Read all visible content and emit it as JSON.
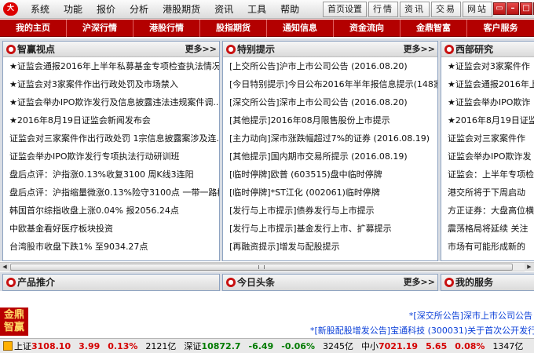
{
  "titlebar": {
    "logo": "大",
    "menu": [
      "系统",
      "功能",
      "报价",
      "分析",
      "港股期货",
      "资讯",
      "工具",
      "帮助"
    ],
    "quick_buttons": [
      "首页设置",
      "行情",
      "资讯",
      "交易",
      "网站"
    ],
    "window_controls": [
      "▭",
      "–",
      "□",
      "✕"
    ]
  },
  "navbar": {
    "items": [
      "我的主页",
      "沪深行情",
      "港股行情",
      "股指期货",
      "通知信息",
      "资金流向",
      "金鼎智富",
      "客户服务"
    ]
  },
  "panels": {
    "zhiying": {
      "title": "智赢视点",
      "more": "更多>>",
      "items": [
        "★证监会通报2016年上半年私募基金专项检查执法情况",
        "★证监会对3家案件作出行政处罚及市场禁入",
        "★证监会举办IPO欺诈发行及信息披露违法违规案件调...",
        "★2016年8月19日证监会新闻发布会",
        "证监会对三家案件作出行政处罚 1宗信息披露案涉及连...",
        "证监会举办IPO欺诈发行专项执法行动研训班",
        "盘后点评：沪指涨0.13%收复3100 周K线3连阳",
        "盘后点评：沪指缩量微涨0.13%险守3100点 一带一路概...",
        "韩国首尔综指收盘上涨0.04% 报2056.24点",
        "中欧基金看好医疗板块投资",
        "台湾股市收盘下跌1% 至9034.27点"
      ]
    },
    "tebie": {
      "title": "特别提示",
      "more": "更多>>",
      "items": [
        "[上交所公告]沪市上市公司公告 (2016.08.20)",
        "[今日特别提示]今日公布2016年半年报信息提示(148家)",
        "[深交所公告]深市上市公司公告 (2016.08.20)",
        "[其他提示]2016年08月限售股份上市提示",
        "[主力动向]深市涨跌幅超过7%的证券 (2016.08.19)",
        "[其他提示]国内期市交易所提示 (2016.08.19)",
        "[临时停牌]欧普 (603515)盘中临时停牌",
        "[临时停牌]*ST江化 (002061)临时停牌",
        "[发行与上市提示]债券发行与上市提示",
        "[发行与上市提示]基金发行上市、扩募提示",
        "[再融资提示]增发与配股提示"
      ]
    },
    "xibu": {
      "title": "西部研究",
      "items": [
        "★证监会对3家案件作",
        "★证监会通报2016年上",
        "★证监会举办IPO欺诈",
        "★2016年8月19日证监会",
        "证监会对三家案件作",
        "证监会举办IPO欺诈发",
        "证监会：上半年专项检",
        "港交所将于下周启动",
        "方正证券：大盘高位横",
        "震荡格局将延续 关注",
        "市场有可能形成新的"
      ]
    }
  },
  "row2": {
    "chanpin": "产品推介",
    "jinri": "今日头条",
    "jinri_more": "更多>>",
    "fuwu": "我的服务"
  },
  "ticker": {
    "brand_line1": "金鼎",
    "brand_line2": "智赢",
    "line1": "*[深交所公告]深市上市公司公告",
    "line2": "*[新股配股增发公告]宝通科技 (300031)关于首次公开发行股票"
  },
  "statusbar": {
    "sh_label": "上证",
    "sh_value": "3108.10",
    "sh_change": "3.99",
    "sh_pct": "0.13%",
    "sh_amount": "2121亿",
    "sz_label": "深证",
    "sz_value": "10872.7",
    "sz_change": "-6.49",
    "sz_pct": "-0.06%",
    "sz_amount": "3245亿",
    "zx_label": "中小",
    "zx_value": "7021.19",
    "zx_change": "5.65",
    "zx_pct": "0.08%",
    "zx_amount": "1347亿"
  },
  "colors": {
    "nav_red": "#b30000",
    "up_red": "#d40000",
    "down_green": "#007b00",
    "ticker_blue": "#0a3fd8",
    "panel_border": "#8ea3c1"
  }
}
